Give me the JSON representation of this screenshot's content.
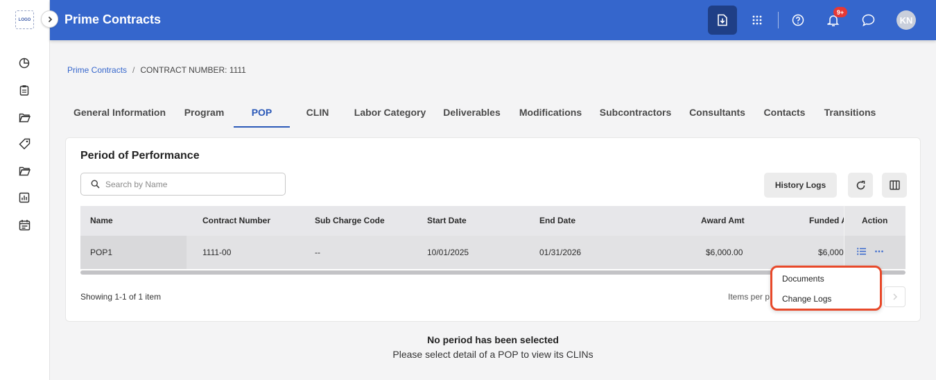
{
  "app": {
    "logo_text": "LOGO",
    "title": "Prime Contracts"
  },
  "header": {
    "notification_badge": "9+",
    "avatar_initials": "KN"
  },
  "breadcrumb": {
    "root": "Prime Contracts",
    "separator": "/",
    "current": "CONTRACT NUMBER: 1111"
  },
  "tabs": [
    {
      "label": "General Information"
    },
    {
      "label": "Program"
    },
    {
      "label": "POP",
      "active": true
    },
    {
      "label": "CLIN"
    },
    {
      "label": "Labor Category"
    },
    {
      "label": "Deliverables"
    },
    {
      "label": "Modifications"
    },
    {
      "label": "Subcontractors"
    },
    {
      "label": "Consultants"
    },
    {
      "label": "Contacts"
    },
    {
      "label": "Transitions"
    }
  ],
  "card": {
    "title": "Period of Performance",
    "search_placeholder": "Search by Name",
    "history_button": "History Logs"
  },
  "table": {
    "columns": [
      "Name",
      "Contract Number",
      "Sub Charge Code",
      "Start Date",
      "End Date",
      "Award Amt",
      "Funded A",
      "Action"
    ],
    "rows": [
      {
        "name": "POP1",
        "contract_number": "1111-00",
        "sub_charge_code": "--",
        "start_date": "10/01/2025",
        "end_date": "01/31/2026",
        "award_amt": "$6,000.00",
        "funded_amt": "$6,000"
      }
    ]
  },
  "pagination": {
    "showing": "Showing 1-1 of 1 item",
    "items_per_page": "Items per p"
  },
  "action_menu": {
    "items": [
      "Documents",
      "Change Logs"
    ]
  },
  "empty_state": {
    "title": "No period has been selected",
    "subtitle": "Please select detail of a POP to view its CLINs"
  },
  "colors": {
    "header": "#3566cc",
    "accent": "#2a58b8",
    "highlight": "#e8492a",
    "badge": "#e53935"
  }
}
